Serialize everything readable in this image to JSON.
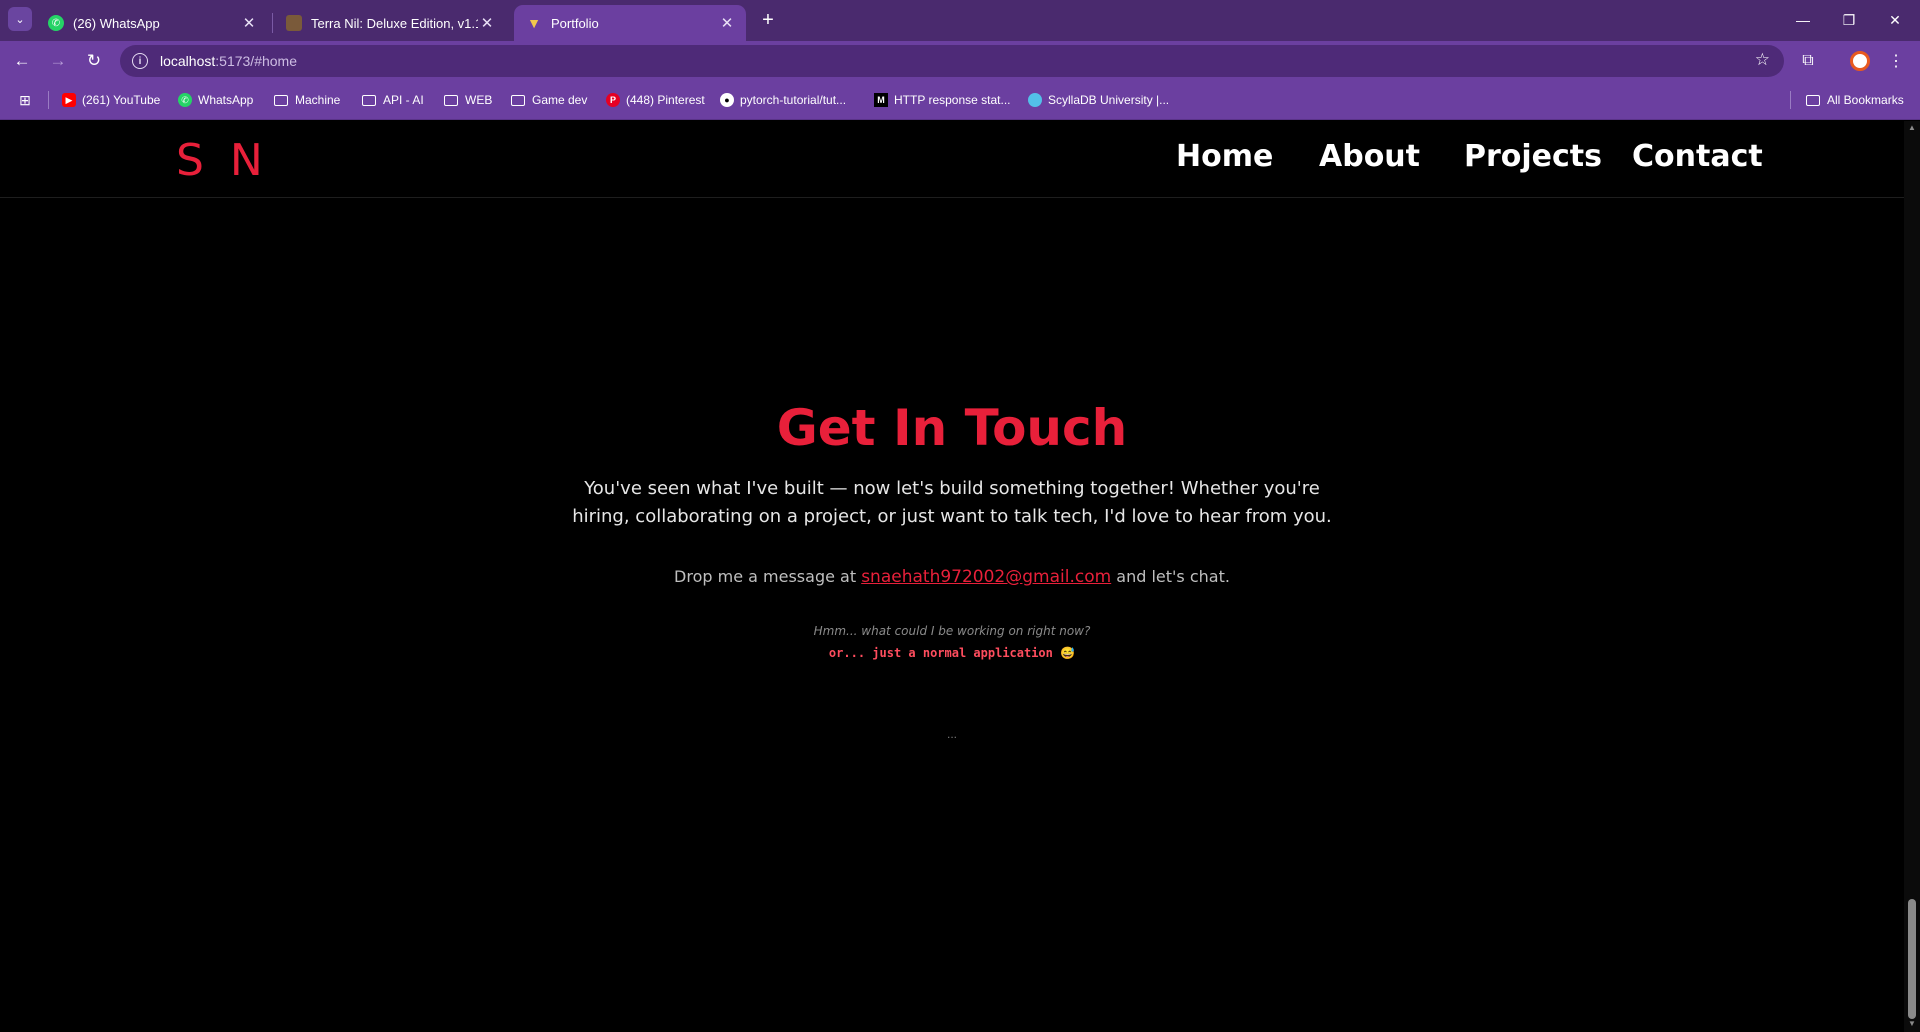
{
  "browser": {
    "tabs": [
      {
        "title": "(26) WhatsApp",
        "icon": "whatsapp-icon",
        "active": false
      },
      {
        "title": "Terra Nil: Deluxe Edition, v1.1.7",
        "icon": "game-thumbnail-icon",
        "active": false
      },
      {
        "title": "Portfolio",
        "icon": "vite-icon",
        "active": true
      }
    ],
    "url_host": "localhost",
    "url_path": ":5173/#home",
    "bookmarks": [
      {
        "label": "(261) YouTube",
        "icon": "youtube-icon"
      },
      {
        "label": "WhatsApp",
        "icon": "whatsapp-icon"
      },
      {
        "label": "Machine",
        "icon": "folder-icon"
      },
      {
        "label": "API - AI",
        "icon": "folder-icon"
      },
      {
        "label": "WEB",
        "icon": "folder-icon"
      },
      {
        "label": "Game dev",
        "icon": "folder-icon"
      },
      {
        "label": "(448) Pinterest",
        "icon": "pinterest-icon"
      },
      {
        "label": "pytorch-tutorial/tut...",
        "icon": "github-icon"
      },
      {
        "label": "HTTP response stat...",
        "icon": "mdn-icon"
      },
      {
        "label": "ScyllaDB University |...",
        "icon": "scylladb-icon"
      }
    ],
    "all_bookmarks": "All Bookmarks",
    "colors": {
      "tabstrip": "#4a2a6e",
      "toolbar": "#6b3fa0"
    }
  },
  "site": {
    "logo": "S N",
    "nav": [
      "Home",
      "About",
      "Projects",
      "Contact"
    ],
    "contact": {
      "heading": "Get In Touch",
      "intro_line1": "You've seen what I've built — now let's build something together! Whether you're",
      "intro_line2": "hiring, collaborating on a project, or just want to talk tech, I'd love to hear from you.",
      "drop_prefix": "Drop me a message at",
      "email": "snaehath972002@gmail.com",
      "drop_suffix": "and let's chat.",
      "teaser": "Hmm... what could I be working on right now?",
      "typing": "or... just a normal application 😅",
      "loading": "..."
    },
    "colors": {
      "accent": "#e8203a",
      "background": "#000000"
    }
  }
}
